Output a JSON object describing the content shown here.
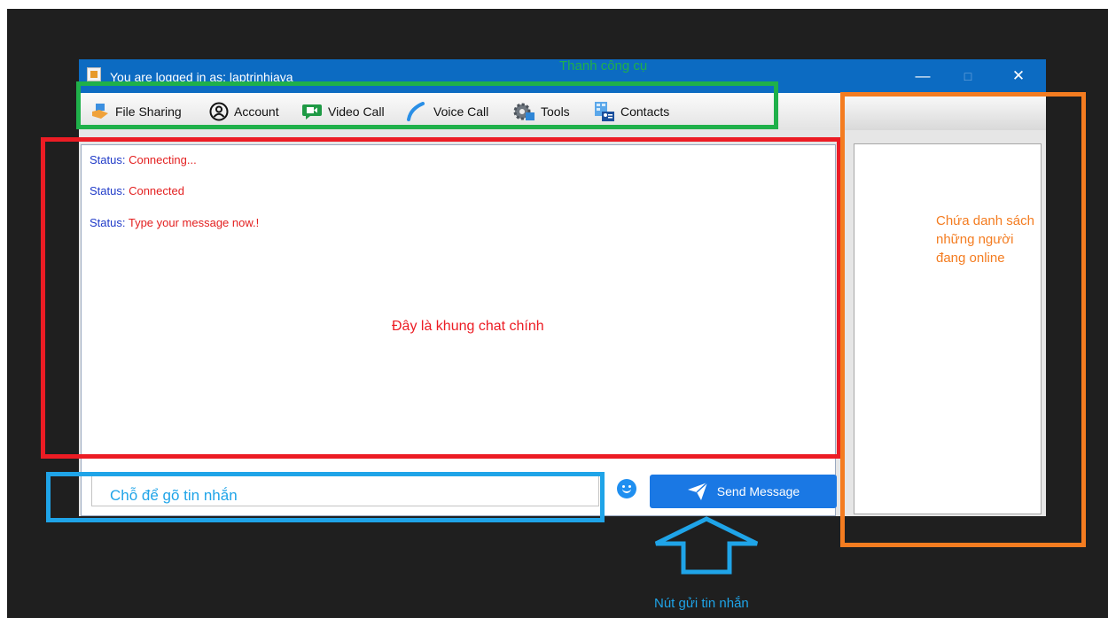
{
  "window": {
    "title": "You are logged in as: laptrinhjava",
    "controls": {
      "minimize": "—",
      "maximize": "□",
      "close": "✕"
    }
  },
  "toolbar": {
    "items": [
      {
        "label": "File Sharing",
        "icon": "file-sharing-icon"
      },
      {
        "label": "Account",
        "icon": "account-icon"
      },
      {
        "label": "Video Call",
        "icon": "video-call-icon"
      },
      {
        "label": "Voice Call",
        "icon": "phone-icon"
      },
      {
        "label": "Tools",
        "icon": "tools-gear-icon"
      },
      {
        "label": "Contacts",
        "icon": "contacts-icon"
      }
    ]
  },
  "chat": {
    "messages": [
      {
        "key": "Status: ",
        "value": "Connecting..."
      },
      {
        "key": "Status: ",
        "value": "Connected"
      },
      {
        "key": "Status: ",
        "value": "Type your message now.!"
      }
    ]
  },
  "composer": {
    "send_label": "Send Message",
    "emoji_icon": "smiley-icon"
  },
  "annotations": {
    "toolbar_label": "Thanh công cụ",
    "chat_label": "Đây là khung chat chính",
    "input_label": "Chỗ để gõ tin nhắn",
    "online_label_lines": [
      "Chứa danh sách",
      "những người",
      "đang online"
    ],
    "send_label": "Nút gửi tin nhắn"
  },
  "colors": {
    "titlebar": "#0c6bc2",
    "send_button": "#1a78e4",
    "status_key": "#1f3ac8",
    "status_value": "#e32020",
    "annotation_green": "#1fb04a",
    "annotation_red": "#ec1c24",
    "annotation_blue": "#1fa4e8",
    "annotation_orange": "#f47c20"
  }
}
